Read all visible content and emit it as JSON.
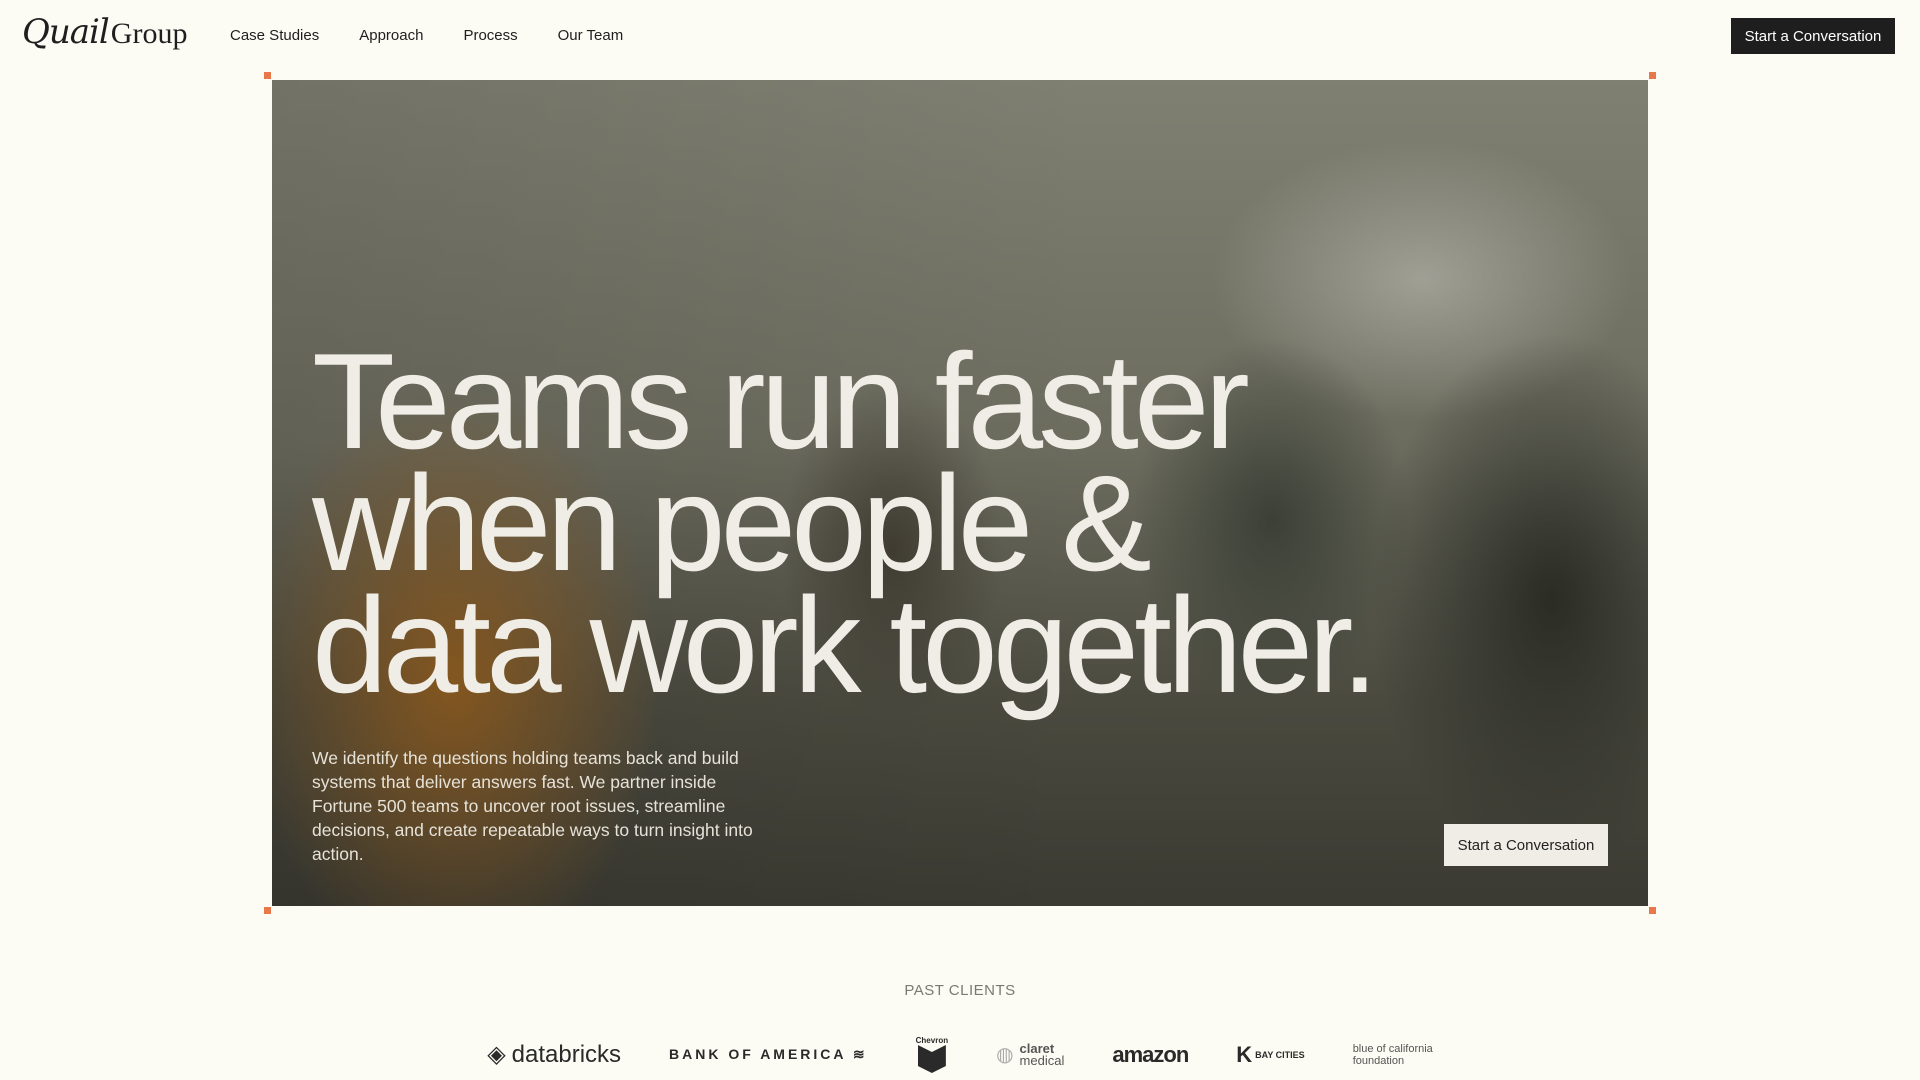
{
  "brand": {
    "script": "Quail",
    "name": "Group"
  },
  "nav": [
    "Case Studies",
    "Approach",
    "Process",
    "Our Team"
  ],
  "cta_top": "Start a Conversation",
  "hero": {
    "headline": [
      "Teams run faster",
      "when people &",
      "data work together."
    ],
    "paragraph": "We identify the questions holding teams back and build systems that deliver answers fast. We partner inside Fortune 500 teams to uncover root issues, streamline decisions, and create repeatable ways to turn insight into action.",
    "cta": "Start a Conversation"
  },
  "clients": {
    "heading": "PAST CLIENTS",
    "logos": {
      "databricks": "databricks",
      "boa": "BANK OF AMERICA",
      "chevron": "Chevron",
      "claret1": "claret",
      "claret2": "medical",
      "amazon": "amazon",
      "baycities": "BAY CITIES",
      "bs1": "blue of california",
      "bs2": "foundation"
    }
  },
  "colors": {
    "background": "#fcfcf4",
    "handle": "#e8774a",
    "button_dark": "#1e1e1e"
  }
}
